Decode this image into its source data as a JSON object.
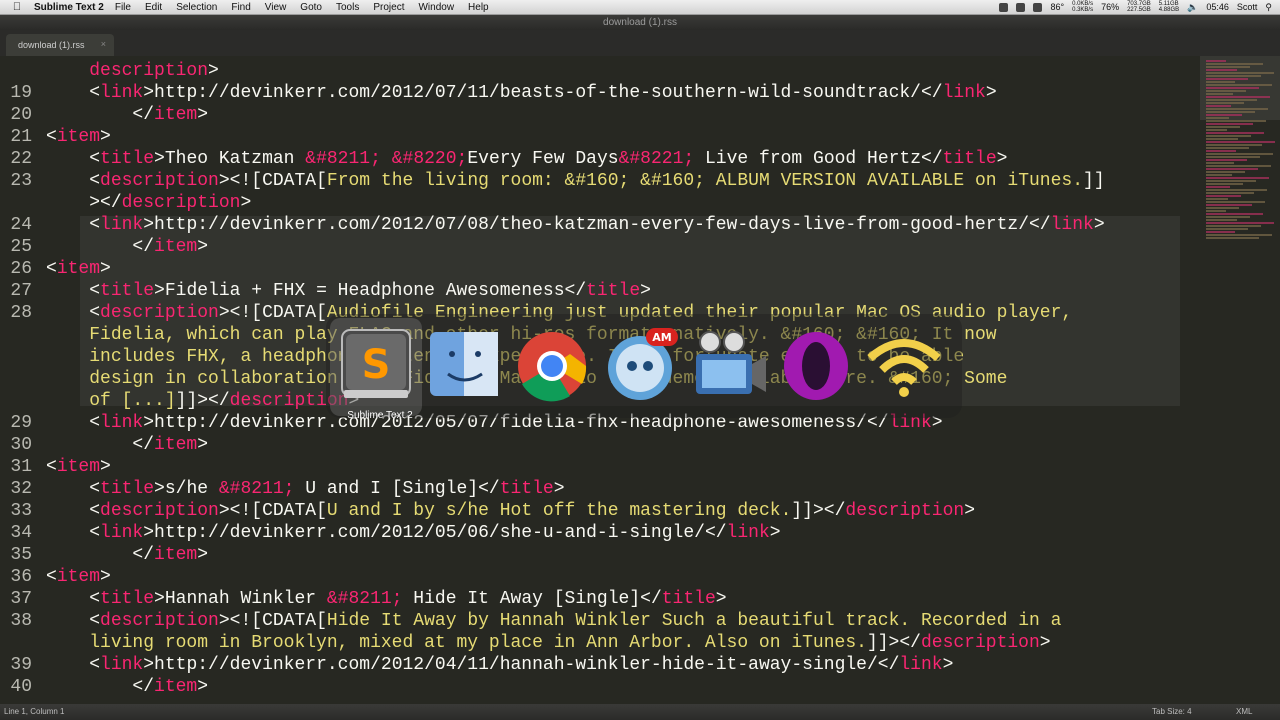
{
  "menubar": {
    "app_name": "Sublime Text 2",
    "items": [
      "File",
      "Edit",
      "Selection",
      "Find",
      "View",
      "Goto",
      "Tools",
      "Project",
      "Window",
      "Help"
    ],
    "temperature": "86°",
    "net_up": "0.0KB/s",
    "net_down": "0.3KB/s",
    "battery": "76%",
    "mem_used": "703.7GB",
    "mem_free": "227.5GB",
    "disk_used": "5.11GB",
    "disk_free": "4.88GB",
    "time": "05:46",
    "user": "Scott"
  },
  "window": {
    "title": "download (1).rss"
  },
  "tab": {
    "label": "download (1).rss",
    "close_glyph": "×"
  },
  "editor": {
    "lines": [
      {
        "num": "",
        "indent": "    ",
        "parts": [
          [
            "tag",
            "description"
          ],
          [
            "plain",
            ">"
          ]
        ]
      },
      {
        "num": "19",
        "indent": "    ",
        "parts": [
          [
            "plain",
            "<"
          ],
          [
            "tag",
            "link"
          ],
          [
            "plain",
            ">http://devinkerr.com/2012/07/11/beasts-of-the-southern-wild-soundtrack/</"
          ],
          [
            "tag",
            "link"
          ],
          [
            "plain",
            ">"
          ]
        ]
      },
      {
        "num": "20",
        "indent": "        ",
        "parts": [
          [
            "plain",
            "</"
          ],
          [
            "tag",
            "item"
          ],
          [
            "plain",
            ">"
          ]
        ]
      },
      {
        "num": "21",
        "indent": "",
        "parts": [
          [
            "plain",
            "<"
          ],
          [
            "tag",
            "item"
          ],
          [
            "plain",
            ">"
          ]
        ]
      },
      {
        "num": "22",
        "indent": "    ",
        "parts": [
          [
            "plain",
            "<"
          ],
          [
            "tag",
            "title"
          ],
          [
            "plain",
            ">Theo Katzman "
          ],
          [
            "tag",
            "&#8211;"
          ],
          [
            "plain",
            " "
          ],
          [
            "tag",
            "&#8220;"
          ],
          [
            "plain",
            "Every Few Days"
          ],
          [
            "tag",
            "&#8221;"
          ],
          [
            "plain",
            " Live from Good Hertz</"
          ],
          [
            "tag",
            "title"
          ],
          [
            "plain",
            ">"
          ]
        ]
      },
      {
        "num": "23",
        "indent": "    ",
        "parts": [
          [
            "plain",
            "<"
          ],
          [
            "tag",
            "description"
          ],
          [
            "plain",
            "><![CDATA["
          ],
          [
            "cdata",
            "From the living room: &#160; &#160; ALBUM VERSION AVAILABLE on iTunes."
          ],
          [
            "plain",
            "]]"
          ]
        ]
      },
      {
        "num": "",
        "indent": "    ",
        "parts": [
          [
            "plain",
            "></"
          ],
          [
            "tag",
            "description"
          ],
          [
            "plain",
            ">"
          ]
        ]
      },
      {
        "num": "24",
        "indent": "    ",
        "parts": [
          [
            "plain",
            "<"
          ],
          [
            "tag",
            "link"
          ],
          [
            "plain",
            ">http://devinkerr.com/2012/07/08/theo-katzman-every-few-days-live-from-good-hertz/</"
          ],
          [
            "tag",
            "link"
          ],
          [
            "plain",
            ">"
          ]
        ]
      },
      {
        "num": "25",
        "indent": "        ",
        "parts": [
          [
            "plain",
            "</"
          ],
          [
            "tag",
            "item"
          ],
          [
            "plain",
            ">"
          ]
        ]
      },
      {
        "num": "26",
        "indent": "",
        "parts": [
          [
            "plain",
            "<"
          ],
          [
            "tag",
            "item"
          ],
          [
            "plain",
            ">"
          ]
        ]
      },
      {
        "num": "27",
        "indent": "    ",
        "parts": [
          [
            "plain",
            "<"
          ],
          [
            "tag",
            "title"
          ],
          [
            "plain",
            ">Fidelia + FHX = Headphone Awesomeness</"
          ],
          [
            "tag",
            "title"
          ],
          [
            "plain",
            ">"
          ]
        ]
      },
      {
        "num": "28",
        "indent": "    ",
        "parts": [
          [
            "plain",
            "<"
          ],
          [
            "tag",
            "description"
          ],
          [
            "plain",
            "><![CDATA["
          ],
          [
            "cdata",
            "Audiofile Engineering just updated their popular Mac OS audio player,"
          ]
        ]
      },
      {
        "num": "",
        "indent": "    ",
        "parts": [
          [
            "cdata",
            "Fidelia, which can play FLAC and other hi-res formats natively. &#160; &#160; It now"
          ]
        ]
      },
      {
        "num": "",
        "indent": "    ",
        "parts": [
          [
            "cdata",
            "includes FHX, a headphone listening experience. I was fortunate enough to be able"
          ]
        ]
      },
      {
        "num": "",
        "indent": "    ",
        "parts": [
          [
            "cdata",
            "design in collaboration with Fidelia. Mac audio free demo available here. &#160; Some"
          ]
        ]
      },
      {
        "num": "",
        "indent": "    ",
        "parts": [
          [
            "cdata",
            "of [...]"
          ],
          [
            "plain",
            "]]></"
          ],
          [
            "tag",
            "description"
          ],
          [
            "plain",
            ">"
          ]
        ]
      },
      {
        "num": "29",
        "indent": "    ",
        "parts": [
          [
            "plain",
            "<"
          ],
          [
            "tag",
            "link"
          ],
          [
            "plain",
            ">http://devinkerr.com/2012/05/07/fidelia-fhx-headphone-awesomeness/</"
          ],
          [
            "tag",
            "link"
          ],
          [
            "plain",
            ">"
          ]
        ]
      },
      {
        "num": "30",
        "indent": "        ",
        "parts": [
          [
            "plain",
            "</"
          ],
          [
            "tag",
            "item"
          ],
          [
            "plain",
            ">"
          ]
        ]
      },
      {
        "num": "31",
        "indent": "",
        "parts": [
          [
            "plain",
            "<"
          ],
          [
            "tag",
            "item"
          ],
          [
            "plain",
            ">"
          ]
        ]
      },
      {
        "num": "32",
        "indent": "    ",
        "parts": [
          [
            "plain",
            "<"
          ],
          [
            "tag",
            "title"
          ],
          [
            "plain",
            ">s/he "
          ],
          [
            "tag",
            "&#8211;"
          ],
          [
            "plain",
            " U and I [Single]</"
          ],
          [
            "tag",
            "title"
          ],
          [
            "plain",
            ">"
          ]
        ]
      },
      {
        "num": "33",
        "indent": "    ",
        "parts": [
          [
            "plain",
            "<"
          ],
          [
            "tag",
            "description"
          ],
          [
            "plain",
            "><![CDATA["
          ],
          [
            "cdata",
            "U and I by s/he Hot off the mastering deck."
          ],
          [
            "plain",
            "]]></"
          ],
          [
            "tag",
            "description"
          ],
          [
            "plain",
            ">"
          ]
        ]
      },
      {
        "num": "34",
        "indent": "    ",
        "parts": [
          [
            "plain",
            "<"
          ],
          [
            "tag",
            "link"
          ],
          [
            "plain",
            ">http://devinkerr.com/2012/05/06/she-u-and-i-single/</"
          ],
          [
            "tag",
            "link"
          ],
          [
            "plain",
            ">"
          ]
        ]
      },
      {
        "num": "35",
        "indent": "        ",
        "parts": [
          [
            "plain",
            "</"
          ],
          [
            "tag",
            "item"
          ],
          [
            "plain",
            ">"
          ]
        ]
      },
      {
        "num": "36",
        "indent": "",
        "parts": [
          [
            "plain",
            "<"
          ],
          [
            "tag",
            "item"
          ],
          [
            "plain",
            ">"
          ]
        ]
      },
      {
        "num": "37",
        "indent": "    ",
        "parts": [
          [
            "plain",
            "<"
          ],
          [
            "tag",
            "title"
          ],
          [
            "plain",
            ">Hannah Winkler "
          ],
          [
            "tag",
            "&#8211;"
          ],
          [
            "plain",
            " Hide It Away [Single]</"
          ],
          [
            "tag",
            "title"
          ],
          [
            "plain",
            ">"
          ]
        ]
      },
      {
        "num": "38",
        "indent": "    ",
        "parts": [
          [
            "plain",
            "<"
          ],
          [
            "tag",
            "description"
          ],
          [
            "plain",
            "><![CDATA["
          ],
          [
            "cdata",
            "Hide It Away by Hannah Winkler Such a beautiful track. Recorded in a"
          ]
        ]
      },
      {
        "num": "",
        "indent": "    ",
        "parts": [
          [
            "cdata",
            "living room in Brooklyn, mixed at my place in Ann Arbor. Also on iTunes."
          ],
          [
            "plain",
            "]]></"
          ],
          [
            "tag",
            "description"
          ],
          [
            "plain",
            ">"
          ]
        ]
      },
      {
        "num": "39",
        "indent": "    ",
        "parts": [
          [
            "plain",
            "<"
          ],
          [
            "tag",
            "link"
          ],
          [
            "plain",
            ">http://devinkerr.com/2012/04/11/hannah-winkler-hide-it-away-single/</"
          ],
          [
            "tag",
            "link"
          ],
          [
            "plain",
            ">"
          ]
        ]
      },
      {
        "num": "40",
        "indent": "        ",
        "parts": [
          [
            "plain",
            "</"
          ],
          [
            "tag",
            "item"
          ],
          [
            "plain",
            ">"
          ]
        ]
      }
    ]
  },
  "statusbar": {
    "position": "Line 1, Column 1",
    "tab_size": "Tab Size: 4",
    "syntax": "XML"
  },
  "app_switcher": {
    "selected_label": "Sublime Text 2",
    "badge": "AM",
    "apps": [
      "sublime-text-2-icon",
      "finder-icon",
      "chrome-icon",
      "tweetbot-icon",
      "imovie-icon",
      "opera-icon",
      "wifi-icon"
    ]
  },
  "colors": {
    "editor_bg": "#272822",
    "tag": "#f92672",
    "string": "#e6db74",
    "text": "#f8f8f2"
  }
}
